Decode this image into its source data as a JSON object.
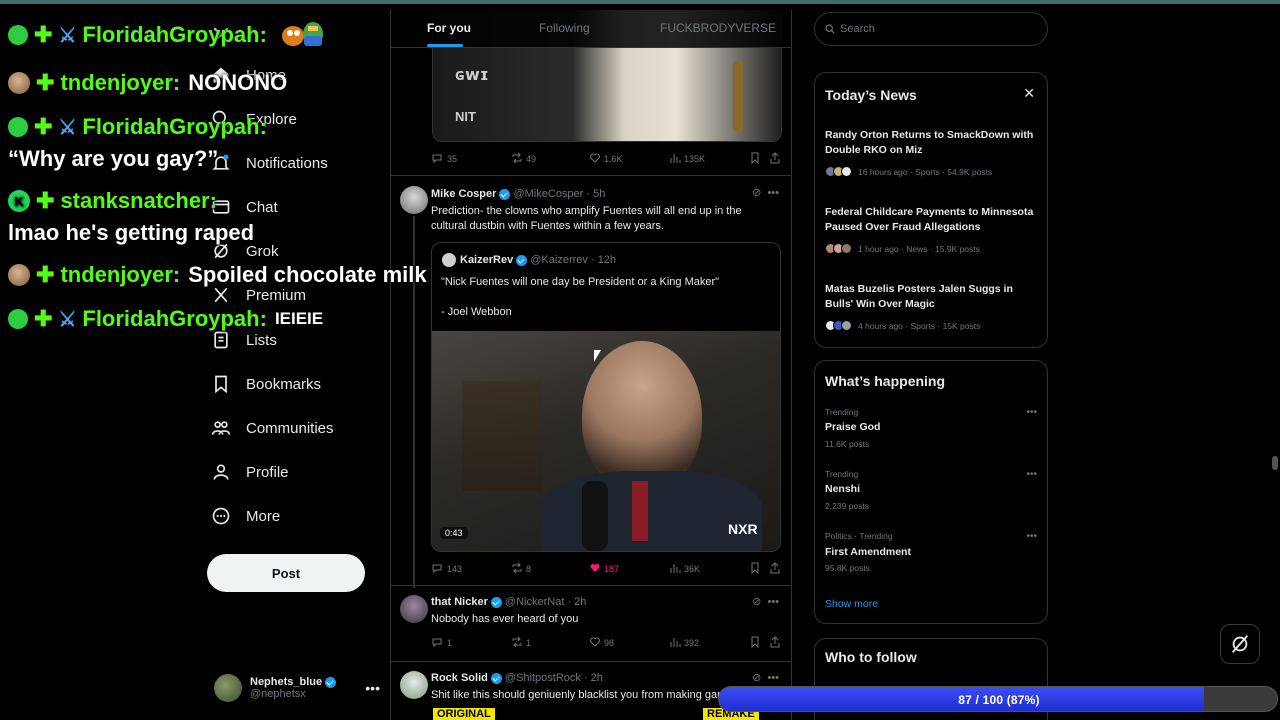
{
  "chat": [
    {
      "badges": [
        "green-dot",
        "cross",
        "sword"
      ],
      "user": "FloridahGroypah:",
      "message": "",
      "emote": "pepe"
    },
    {
      "badges": [
        "face",
        "cross"
      ],
      "user": "tndenjoyer:",
      "message": "NONONO"
    },
    {
      "badges": [
        "green-dot",
        "cross",
        "sword"
      ],
      "user": "FloridahGroypah:",
      "message": ""
    },
    {
      "badges": [],
      "user": "",
      "message": "“Why are you gay?”"
    },
    {
      "badges": [
        "k",
        "cross"
      ],
      "user": "stanksnatcher:",
      "message": ""
    },
    {
      "badges": [],
      "user": "",
      "message": "lmao he's getting raped"
    },
    {
      "badges": [
        "face",
        "cross"
      ],
      "user": "tndenjoyer:",
      "message": "Spoiled chocolate milk"
    },
    {
      "badges": [
        "green-dot",
        "cross",
        "sword"
      ],
      "user": "FloridahGroypah:",
      "message": "IEIEIE"
    }
  ],
  "nav": {
    "items": [
      {
        "label": "Home",
        "icon": "home-icon"
      },
      {
        "label": "Explore",
        "icon": "search-icon"
      },
      {
        "label": "Notifications",
        "icon": "bell-icon"
      },
      {
        "label": "Chat",
        "icon": "mail-icon"
      },
      {
        "label": "Grok",
        "icon": "grok-icon"
      },
      {
        "label": "Premium",
        "icon": "x-logo-icon"
      },
      {
        "label": "Lists",
        "icon": "list-icon"
      },
      {
        "label": "Bookmarks",
        "icon": "bookmark-icon"
      },
      {
        "label": "Communities",
        "icon": "people-icon"
      },
      {
        "label": "Profile",
        "icon": "person-icon"
      },
      {
        "label": "More",
        "icon": "more-circle-icon"
      }
    ],
    "post_label": "Post",
    "account": {
      "name": "Nephets_blue",
      "handle": "@nephetsx"
    }
  },
  "feed": {
    "tabs": [
      "For you",
      "Following",
      "FUCKBRODYVERSE"
    ],
    "active_tab": "For you",
    "top_post_stats": {
      "replies": "35",
      "reposts": "49",
      "likes": "1.6K",
      "views": "135K"
    },
    "posts": [
      {
        "author": "Mike Cosper",
        "handle": "@MikeCosper",
        "time": "· 5h",
        "text": "Prediction- the clowns who amplify Fuentes will all end up in the cultural dustbin with Fuentes within a few years.",
        "quote": {
          "author": "KaizerRev",
          "handle": "@Kaizerrev",
          "time": "· 12h",
          "text": "\"Nick Fuentes will one day be President or a King Maker\"",
          "attribution": "- Joel Webbon",
          "video_duration": "0:43",
          "watermark": "NXR"
        },
        "stats": {
          "replies": "143",
          "reposts": "8",
          "likes": "187",
          "views": "36K"
        }
      },
      {
        "author": "that Nicker",
        "handle": "@NickerNat",
        "time": "· 2h",
        "text": "Nobody has ever heard of you",
        "stats": {
          "replies": "1",
          "reposts": "1",
          "likes": "98",
          "views": "392"
        }
      },
      {
        "author": "Rock Solid",
        "handle": "@ShitpostRock",
        "time": "· 2h",
        "text": "Shit like this should geniuenly blacklist you from making game",
        "media_labels": [
          "ORIGINAL",
          "REMAKE"
        ]
      }
    ]
  },
  "right": {
    "search_placeholder": "Search",
    "news": {
      "title": "Today’s News",
      "items": [
        {
          "title": "Randy Orton Returns to SmackDown with Double RKO on Miz",
          "meta": "16 hours ago · Sports · 54.9K posts"
        },
        {
          "title": "Federal Childcare Payments to Minnesota Paused Over Fraud Allegations",
          "meta": "1 hour ago · News · 15.9K posts"
        },
        {
          "title": "Matas Buzelis Posters Jalen Suggs in Bulls' Win Over Magic",
          "meta": "4 hours ago · Sports · 15K posts"
        }
      ]
    },
    "happening": {
      "title": "What’s happening",
      "items": [
        {
          "category": "Trending",
          "name": "Praise God",
          "count": "11.6K posts"
        },
        {
          "category": "Trending",
          "name": "Nenshi",
          "count": "2,239 posts"
        },
        {
          "category": "Politics · Trending",
          "name": "First Amendment",
          "count": "95.8K posts"
        }
      ],
      "show_more": "Show more"
    },
    "who_to_follow": "Who to follow"
  },
  "progress": {
    "label": "87 / 100 (87%)",
    "fraction": 0.87
  },
  "colors": {
    "accent": "#1d9bf0",
    "chat_name": "#53fc18",
    "like_active": "#f91880",
    "progress_fill": "#2d3fe6"
  }
}
